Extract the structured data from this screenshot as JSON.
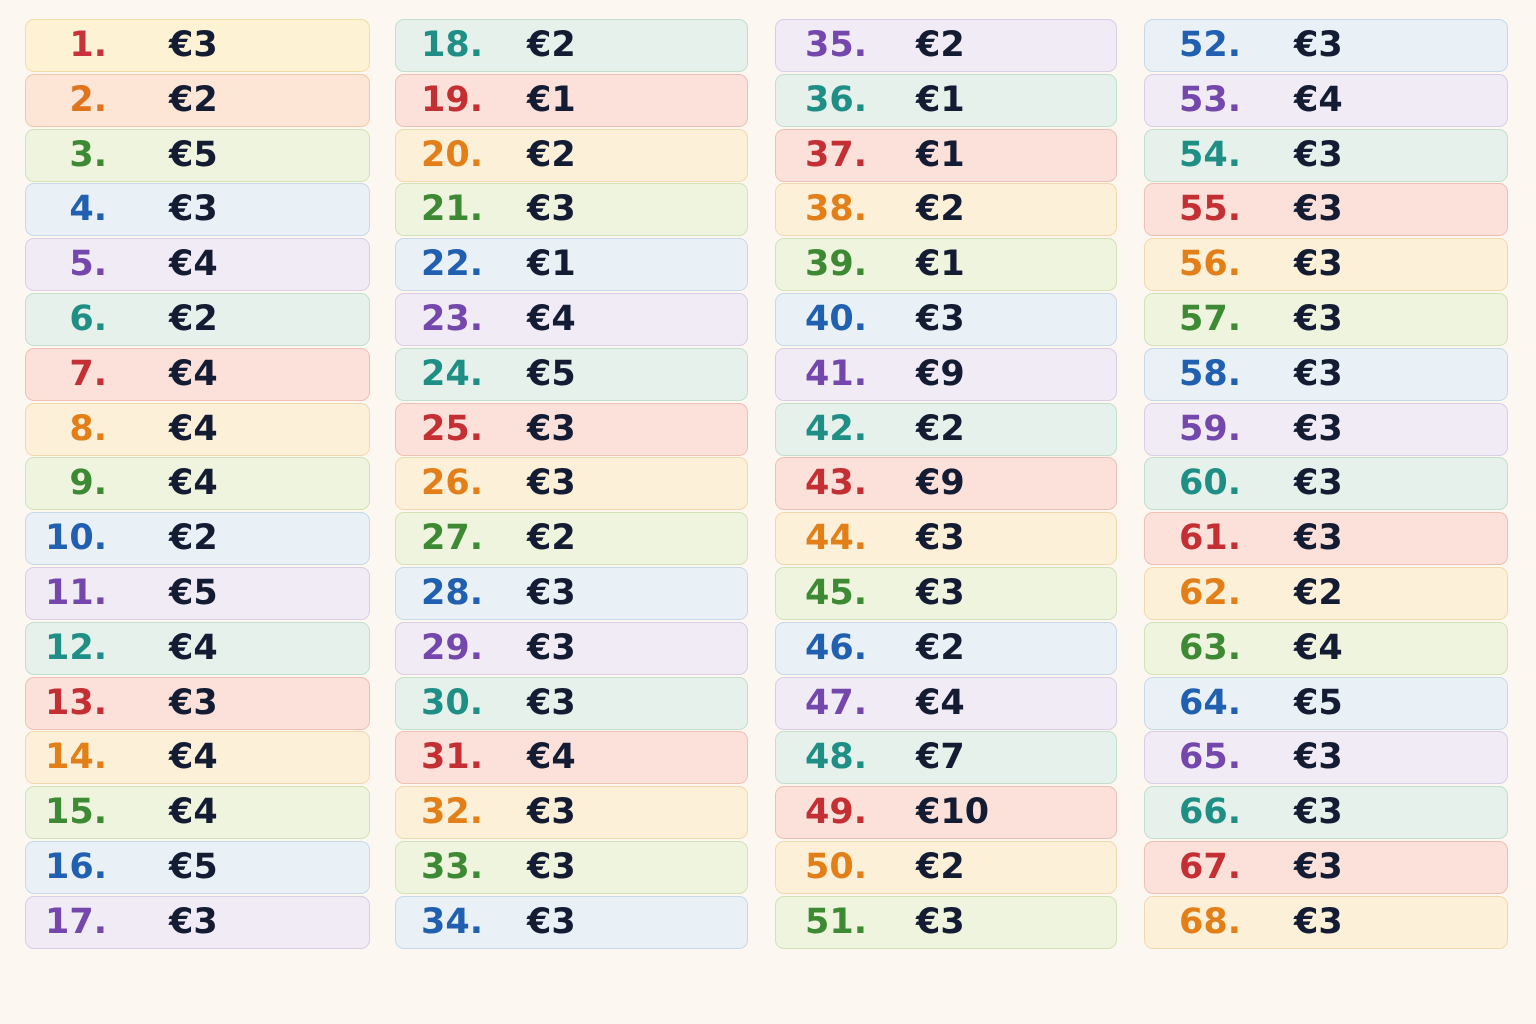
{
  "columns": [
    [
      {
        "n": "1.",
        "p": "€3",
        "c": 0
      },
      {
        "n": "2.",
        "p": "€2",
        "c": 1
      },
      {
        "n": "3.",
        "p": "€5",
        "c": 2
      },
      {
        "n": "4.",
        "p": "€3",
        "c": 3
      },
      {
        "n": "5.",
        "p": "€4",
        "c": 4
      },
      {
        "n": "6.",
        "p": "€2",
        "c": 5
      },
      {
        "n": "7.",
        "p": "€4",
        "c": 6
      },
      {
        "n": "8.",
        "p": "€4",
        "c": 7
      },
      {
        "n": "9.",
        "p": "€4",
        "c": 2
      },
      {
        "n": "10.",
        "p": "€2",
        "c": 3
      },
      {
        "n": "11.",
        "p": "€5",
        "c": 4
      },
      {
        "n": "12.",
        "p": "€4",
        "c": 5
      },
      {
        "n": "13.",
        "p": "€3",
        "c": 6
      },
      {
        "n": "14.",
        "p": "€4",
        "c": 7
      },
      {
        "n": "15.",
        "p": "€4",
        "c": 2
      },
      {
        "n": "16.",
        "p": "€5",
        "c": 3
      },
      {
        "n": "17.",
        "p": "€3",
        "c": 4
      }
    ],
    [
      {
        "n": "18.",
        "p": "€2",
        "c": 5
      },
      {
        "n": "19.",
        "p": "€1",
        "c": 6
      },
      {
        "n": "20.",
        "p": "€2",
        "c": 7
      },
      {
        "n": "21.",
        "p": "€3",
        "c": 2
      },
      {
        "n": "22.",
        "p": "€1",
        "c": 3
      },
      {
        "n": "23.",
        "p": "€4",
        "c": 4
      },
      {
        "n": "24.",
        "p": "€5",
        "c": 5
      },
      {
        "n": "25.",
        "p": "€3",
        "c": 6
      },
      {
        "n": "26.",
        "p": "€3",
        "c": 7
      },
      {
        "n": "27.",
        "p": "€2",
        "c": 2
      },
      {
        "n": "28.",
        "p": "€3",
        "c": 3
      },
      {
        "n": "29.",
        "p": "€3",
        "c": 4
      },
      {
        "n": "30.",
        "p": "€3",
        "c": 5
      },
      {
        "n": "31.",
        "p": "€4",
        "c": 6
      },
      {
        "n": "32.",
        "p": "€3",
        "c": 7
      },
      {
        "n": "33.",
        "p": "€3",
        "c": 2
      },
      {
        "n": "34.",
        "p": "€3",
        "c": 3
      }
    ],
    [
      {
        "n": "35.",
        "p": "€2",
        "c": 4
      },
      {
        "n": "36.",
        "p": "€1",
        "c": 5
      },
      {
        "n": "37.",
        "p": "€1",
        "c": 6
      },
      {
        "n": "38.",
        "p": "€2",
        "c": 7
      },
      {
        "n": "39.",
        "p": "€1",
        "c": 2
      },
      {
        "n": "40.",
        "p": "€3",
        "c": 3
      },
      {
        "n": "41.",
        "p": "€9",
        "c": 4
      },
      {
        "n": "42.",
        "p": "€2",
        "c": 5
      },
      {
        "n": "43.",
        "p": "€9",
        "c": 6
      },
      {
        "n": "44.",
        "p": "€3",
        "c": 7
      },
      {
        "n": "45.",
        "p": "€3",
        "c": 2
      },
      {
        "n": "46.",
        "p": "€2",
        "c": 3
      },
      {
        "n": "47.",
        "p": "€4",
        "c": 4
      },
      {
        "n": "48.",
        "p": "€7",
        "c": 5
      },
      {
        "n": "49.",
        "p": "€10",
        "c": 6
      },
      {
        "n": "50.",
        "p": "€2",
        "c": 7
      },
      {
        "n": "51.",
        "p": "€3",
        "c": 2
      }
    ],
    [
      {
        "n": "52.",
        "p": "€3",
        "c": 3
      },
      {
        "n": "53.",
        "p": "€4",
        "c": 4
      },
      {
        "n": "54.",
        "p": "€3",
        "c": 5
      },
      {
        "n": "55.",
        "p": "€3",
        "c": 6
      },
      {
        "n": "56.",
        "p": "€3",
        "c": 7
      },
      {
        "n": "57.",
        "p": "€3",
        "c": 2
      },
      {
        "n": "58.",
        "p": "€3",
        "c": 3
      },
      {
        "n": "59.",
        "p": "€3",
        "c": 4
      },
      {
        "n": "60.",
        "p": "€3",
        "c": 5
      },
      {
        "n": "61.",
        "p": "€3",
        "c": 6
      },
      {
        "n": "62.",
        "p": "€2",
        "c": 7
      },
      {
        "n": "63.",
        "p": "€4",
        "c": 2
      },
      {
        "n": "64.",
        "p": "€5",
        "c": 3
      },
      {
        "n": "65.",
        "p": "€3",
        "c": 4
      },
      {
        "n": "66.",
        "p": "€3",
        "c": 5
      },
      {
        "n": "67.",
        "p": "€3",
        "c": 6
      },
      {
        "n": "68.",
        "p": "€3",
        "c": 7
      }
    ]
  ]
}
